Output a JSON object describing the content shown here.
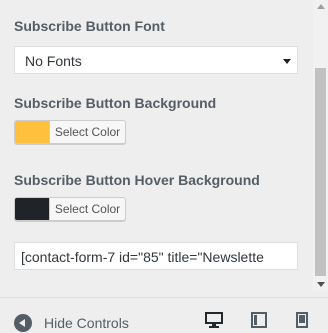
{
  "sections": {
    "font": {
      "title": "Subscribe Button Font",
      "selected": "No Fonts"
    },
    "background": {
      "title": "Subscribe Button Background",
      "color": "#ffc03d",
      "button_label": "Select Color"
    },
    "hover": {
      "title": "Subscribe Button Hover Background",
      "color": "#202428",
      "button_label": "Select Color"
    },
    "shortcode": {
      "value": "[contact-form-7 id=\"85\" title=\"Newslette"
    }
  },
  "footer": {
    "hide_controls_label": "Hide Controls",
    "devices": [
      "desktop-icon",
      "tablet-icon",
      "mobile-icon"
    ]
  }
}
